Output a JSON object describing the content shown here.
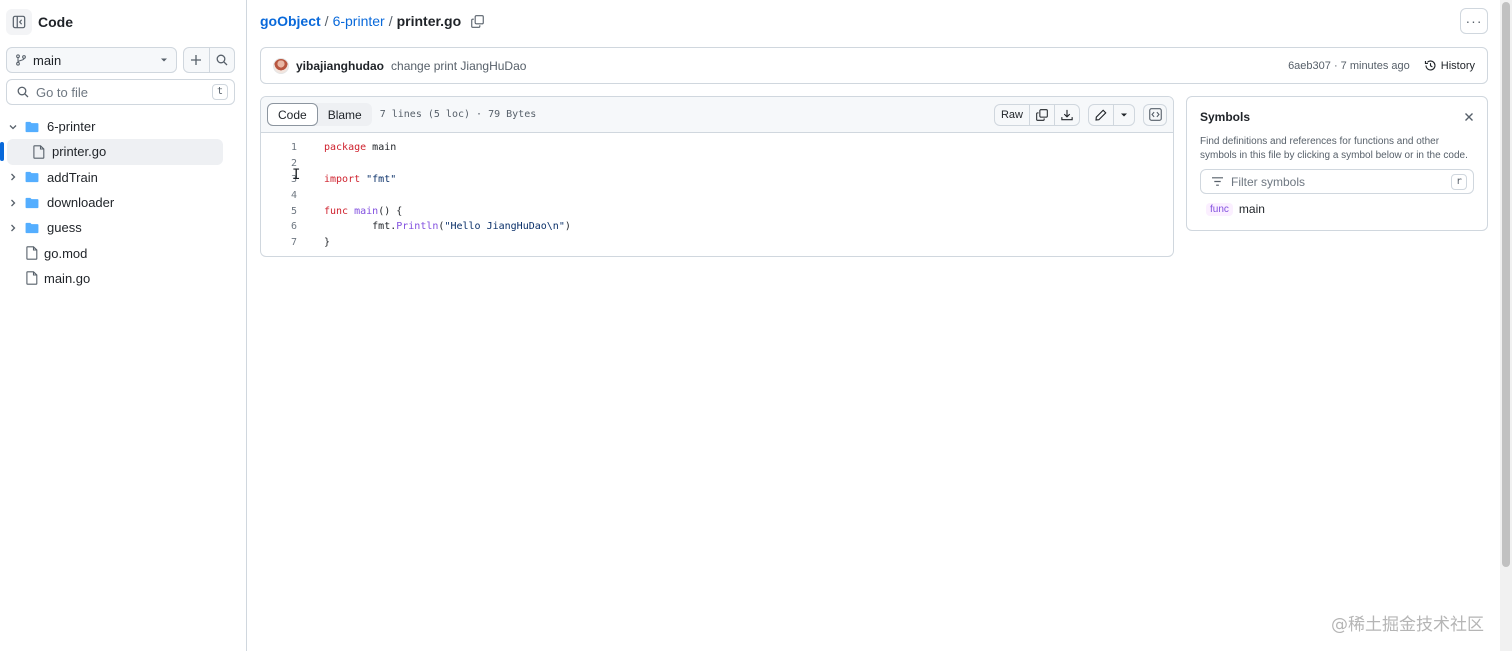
{
  "sidebar": {
    "title": "Code",
    "branch": "main",
    "goto_placeholder": "Go to file",
    "goto_shortcut": "t",
    "tree": [
      {
        "label": "6-printer",
        "type": "folder",
        "expanded": true
      },
      {
        "label": "printer.go",
        "type": "file",
        "selected": true
      },
      {
        "label": "addTrain",
        "type": "folder",
        "expanded": false
      },
      {
        "label": "downloader",
        "type": "folder",
        "expanded": false
      },
      {
        "label": "guess",
        "type": "folder",
        "expanded": false
      },
      {
        "label": "go.mod",
        "type": "file"
      },
      {
        "label": "main.go",
        "type": "file"
      }
    ]
  },
  "breadcrumb": {
    "repo": "goObject",
    "sep1": "/",
    "folder": "6-printer",
    "sep2": "/",
    "file": "printer.go"
  },
  "more_label": "···",
  "commit": {
    "author": "yibajianghudao",
    "message": "change print JiangHuDao",
    "meta": "6aeb307 · 7 minutes ago",
    "history_label": "History"
  },
  "code_view": {
    "tab_code": "Code",
    "tab_blame": "Blame",
    "file_info": "7 lines (5 loc) · 79 Bytes",
    "raw_label": "Raw",
    "lines": [
      {
        "n": "1"
      },
      {
        "n": "2"
      },
      {
        "n": "3"
      },
      {
        "n": "4"
      },
      {
        "n": "5"
      },
      {
        "n": "6"
      },
      {
        "n": "7"
      }
    ],
    "tokens": {
      "l1_kw": "package",
      "l1_rest": " main",
      "l3_kw": "import",
      "l3_str": " \"fmt\"",
      "l5_kw": "func",
      "l5_fn": " main",
      "l5_rest": "() {",
      "l6_pre": "        fmt.",
      "l6_fn": "Println",
      "l6_p1": "(",
      "l6_str": "\"Hello JiangHuDao\\n\"",
      "l6_p2": ")",
      "l7": "}"
    }
  },
  "symbols": {
    "title": "Symbols",
    "description": "Find definitions and references for functions and other symbols in this file by clicking a symbol below or in the code.",
    "filter_placeholder": "Filter symbols",
    "filter_shortcut": "r",
    "items": [
      {
        "kind": "func",
        "name": "main"
      }
    ]
  },
  "watermark": "@稀土掘金技术社区",
  "colors": {
    "accent": "#0969da",
    "border": "#d0d7de",
    "keyword": "#cf222e",
    "string": "#0a3069",
    "function": "#8250df"
  }
}
